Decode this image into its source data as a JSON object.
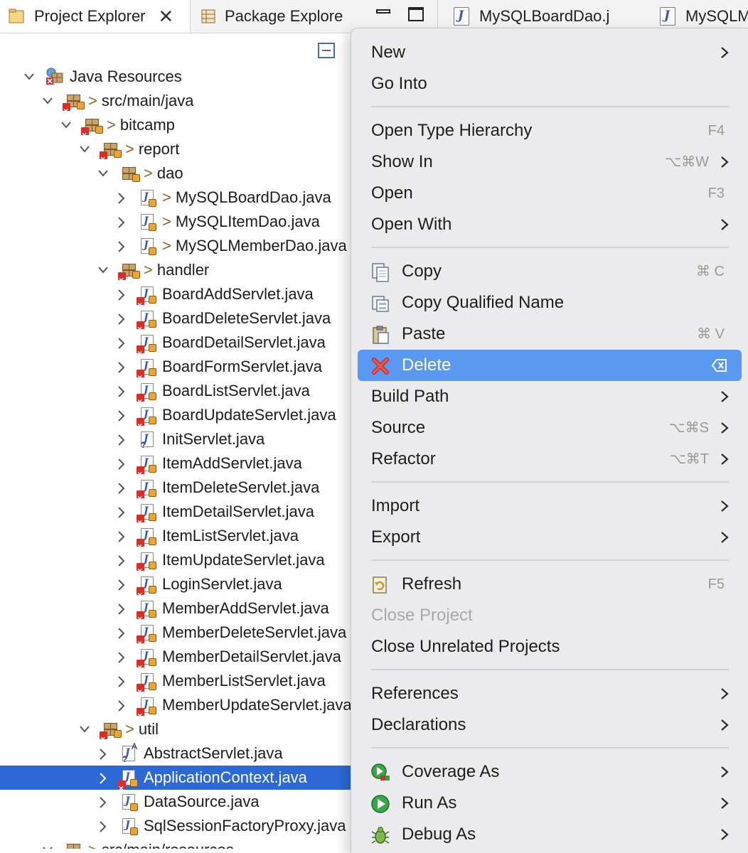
{
  "tabs": {
    "project_explorer": "Project Explorer",
    "package_explorer": "Package Explore",
    "editor_tab1": "MySQLBoardDao.j",
    "editor_tab2": "MySQLM"
  },
  "tree": {
    "java_resources": "Java Resources",
    "src_main_java": "src/main/java",
    "bitcamp": "bitcamp",
    "report": "report",
    "dao": "dao",
    "dao_files": [
      "MySQLBoardDao.java",
      "MySQLItemDao.java",
      "MySQLMemberDao.java"
    ],
    "handler": "handler",
    "handler_files": [
      "BoardAddServlet.java",
      "BoardDeleteServlet.java",
      "BoardDetailServlet.java",
      "BoardFormServlet.java",
      "BoardListServlet.java",
      "BoardUpdateServlet.java",
      "InitServlet.java",
      "ItemAddServlet.java",
      "ItemDeleteServlet.java",
      "ItemDetailServlet.java",
      "ItemListServlet.java",
      "ItemUpdateServlet.java",
      "LoginServlet.java",
      "MemberAddServlet.java",
      "MemberDeleteServlet.java",
      "MemberDetailServlet.java",
      "MemberListServlet.java",
      "MemberUpdateServlet.java"
    ],
    "util": "util",
    "util_files": [
      "AbstractServlet.java",
      "ApplicationContext.java",
      "DataSource.java",
      "SqlSessionFactoryProxy.java"
    ],
    "selected_item": "ApplicationContext.java",
    "src_main_resources": "src/main/resources"
  },
  "menu": {
    "new": "New",
    "go_into": "Go Into",
    "open_type_hierarchy": "Open Type Hierarchy",
    "open_type_hierarchy_sc": "F4",
    "show_in": "Show In",
    "show_in_sc": "⌥⌘W",
    "open": "Open",
    "open_sc": "F3",
    "open_with": "Open With",
    "copy": "Copy",
    "copy_sc": "⌘ C",
    "copy_qualified_name": "Copy Qualified Name",
    "paste": "Paste",
    "paste_sc": "⌘ V",
    "delete": "Delete",
    "build_path": "Build Path",
    "source": "Source",
    "source_sc": "⌥⌘S",
    "refactor": "Refactor",
    "refactor_sc": "⌥⌘T",
    "import": "Import",
    "export": "Export",
    "refresh": "Refresh",
    "refresh_sc": "F5",
    "close_project": "Close Project",
    "close_unrelated_projects": "Close Unrelated Projects",
    "references": "References",
    "declarations": "Declarations",
    "coverage_as": "Coverage As",
    "run_as": "Run As",
    "debug_as": "Debug As"
  }
}
